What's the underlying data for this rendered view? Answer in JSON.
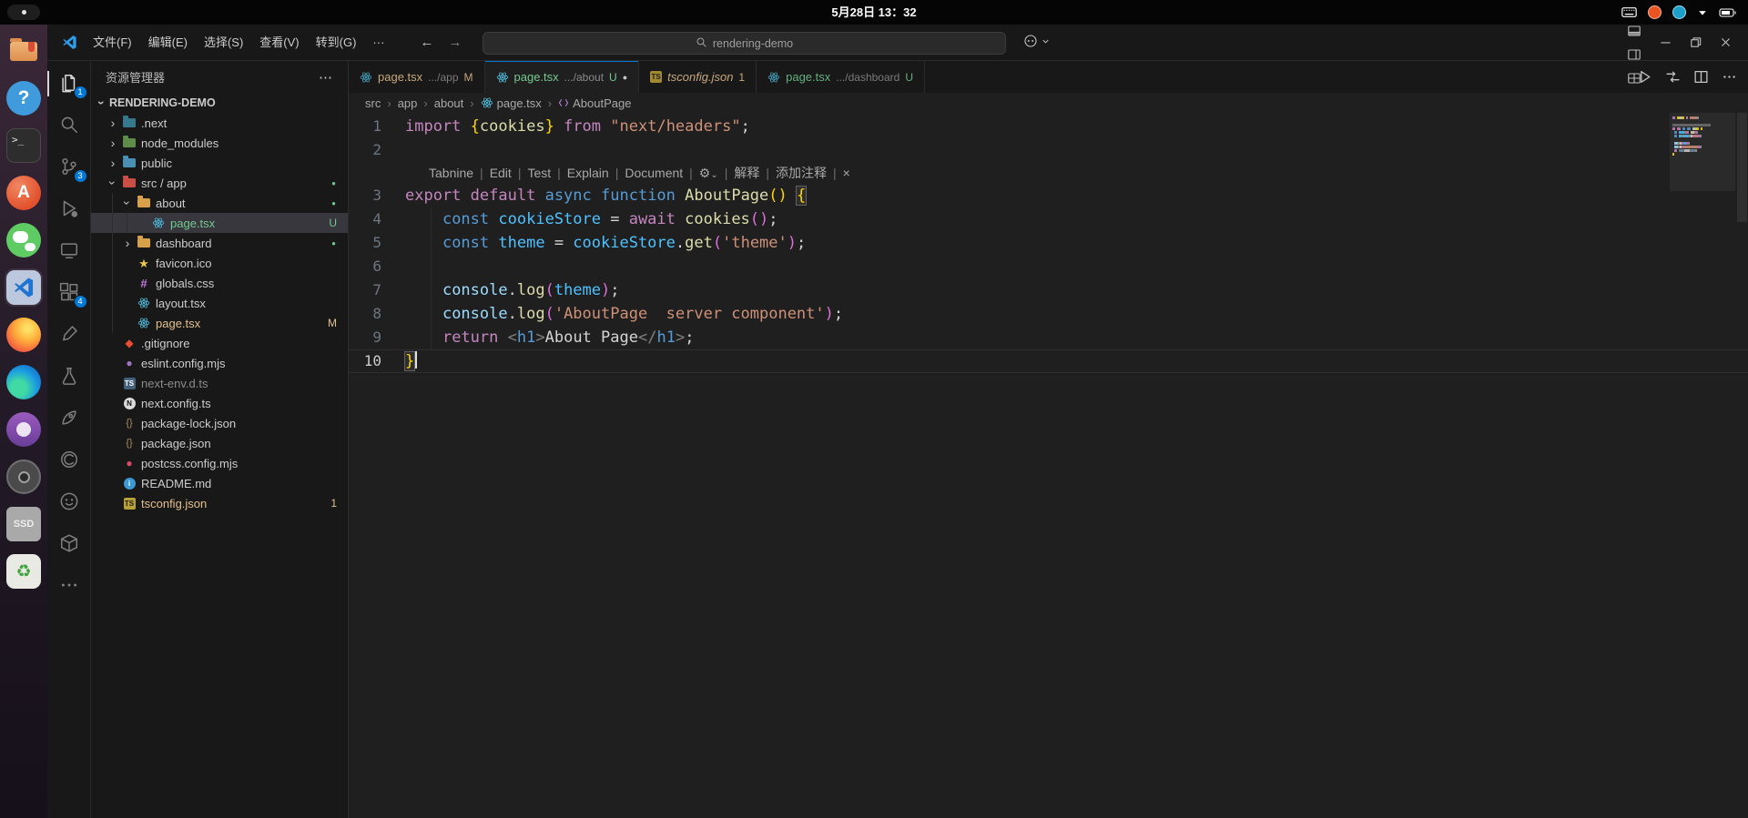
{
  "system_bar": {
    "clock": "5月28日 13：32",
    "tray": [
      "keyboard",
      "recording",
      "network-app",
      "arrow-down",
      "battery"
    ]
  },
  "dock": {
    "items": [
      {
        "name": "file-manager"
      },
      {
        "name": "help"
      },
      {
        "name": "terminal"
      },
      {
        "name": "app-center"
      },
      {
        "name": "wechat"
      },
      {
        "name": "vscode",
        "active": true
      },
      {
        "name": "firefox"
      },
      {
        "name": "edge"
      },
      {
        "name": "purple-app"
      },
      {
        "name": "screenshot-tool"
      },
      {
        "name": "ssd-disk",
        "label": "SSD"
      },
      {
        "name": "recycle-bin"
      }
    ]
  },
  "vscode": {
    "colors": {
      "accent": "#0078D4",
      "git_untracked": "#73C991",
      "git_modified": "#E2C08D"
    },
    "titlebar": {
      "menus": [
        "文件(F)",
        "编辑(E)",
        "选择(S)",
        "查看(V)",
        "转到(G)",
        "···"
      ],
      "search_value": "rendering-demo",
      "layout_buttons": [
        "toggle-sidebar",
        "toggle-panel",
        "toggle-secondary-sidebar",
        "customize-layout"
      ],
      "window_controls": [
        "minimize",
        "restore",
        "close"
      ]
    },
    "activity_bar": {
      "items": [
        {
          "name": "explorer",
          "badge": "1",
          "active": true
        },
        {
          "name": "search"
        },
        {
          "name": "source-control",
          "badge": "3"
        },
        {
          "name": "run-debug"
        },
        {
          "name": "remote-explorer"
        },
        {
          "name": "extensions",
          "badge": "4"
        },
        {
          "name": "brush"
        },
        {
          "name": "testing"
        },
        {
          "name": "rocket"
        },
        {
          "name": "devtools"
        },
        {
          "name": "github"
        },
        {
          "name": "package"
        },
        {
          "name": "more"
        }
      ]
    },
    "sidebar": {
      "title": "资源管理器",
      "more_label": "⋯",
      "project": "RENDERING-DEMO",
      "tree": [
        {
          "label": ".next",
          "icon": "folder",
          "color": "#37798C",
          "level": 0,
          "chevron": "collapsed"
        },
        {
          "label": "node_modules",
          "icon": "folder",
          "color": "#5E8D49",
          "level": 0,
          "chevron": "collapsed"
        },
        {
          "label": "public",
          "icon": "folder",
          "color": "#4A8FB5",
          "level": 0,
          "chevron": "collapsed"
        },
        {
          "label": "src / app",
          "icon": "folder",
          "color": "#C94F46",
          "level": 0,
          "chevron": "expanded",
          "dot": true
        },
        {
          "label": "about",
          "icon": "folder",
          "color": "#D9A04A",
          "level": 1,
          "chevron": "expanded",
          "dot": true
        },
        {
          "label": "page.tsx",
          "icon": "react",
          "level": 2,
          "badge": "U",
          "text_color": "#73C991",
          "selected": true
        },
        {
          "label": "dashboard",
          "icon": "folder",
          "color": "#D9A04A",
          "level": 1,
          "chevron": "collapsed",
          "dot": true
        },
        {
          "label": "favicon.ico",
          "icon": "star",
          "level": 1
        },
        {
          "label": "globals.css",
          "icon": "css",
          "level": 1
        },
        {
          "label": "layout.tsx",
          "icon": "react",
          "level": 1
        },
        {
          "label": "page.tsx",
          "icon": "react",
          "level": 1,
          "badge": "M",
          "text_color": "#E2C08D"
        },
        {
          "label": ".gitignore",
          "icon": "git",
          "level": 0
        },
        {
          "label": "eslint.config.mjs",
          "icon": "eslint",
          "level": 0
        },
        {
          "label": "next-env.d.ts",
          "icon": "ts",
          "level": 0,
          "text_color": "#8C8C8C"
        },
        {
          "label": "next.config.ts",
          "icon": "next",
          "level": 0
        },
        {
          "label": "package-lock.json",
          "icon": "json",
          "level": 0
        },
        {
          "label": "package.json",
          "icon": "json",
          "level": 0
        },
        {
          "label": "postcss.config.mjs",
          "icon": "postcss",
          "level": 0
        },
        {
          "label": "README.md",
          "icon": "info",
          "level": 0
        },
        {
          "label": "tsconfig.json",
          "icon": "tsconfig",
          "level": 0,
          "badge": "1",
          "text_color": "#E2C08D"
        }
      ]
    },
    "tabs": [
      {
        "icon": "react",
        "name": "page.tsx",
        "hint": ".../app",
        "badge": "M",
        "badge_color": "#E2C08D",
        "name_color": "#E2C08D",
        "active": false
      },
      {
        "icon": "react",
        "name": "page.tsx",
        "hint": ".../about",
        "badge": "U",
        "badge_color": "#73C991",
        "name_color": "#73C991",
        "active": true,
        "dirty": true
      },
      {
        "icon": "tsconfig",
        "name": "tsconfig.json",
        "hint": "",
        "badge": "1",
        "badge_color": "#E2C08D",
        "name_color": "#E2C08D",
        "italic": true,
        "active": false
      },
      {
        "icon": "react",
        "name": "page.tsx",
        "hint": ".../dashboard",
        "badge": "U",
        "badge_color": "#73C991",
        "name_color": "#73C991",
        "active": false
      }
    ],
    "editor_actions": [
      "run",
      "compare",
      "split-editor",
      "more"
    ],
    "breadcrumbs": [
      {
        "label": "src"
      },
      {
        "label": "app"
      },
      {
        "label": "about"
      },
      {
        "label": "page.tsx",
        "icon": "react"
      },
      {
        "label": "AboutPage",
        "icon": "symbol"
      }
    ],
    "editor": {
      "codelens": {
        "items": [
          "Tabnine",
          "Edit",
          "Test",
          "Explain",
          "Document"
        ],
        "gear": "⚙",
        "items_cn": [
          "解释",
          "添加注释"
        ],
        "close": "×"
      },
      "lines": [
        {
          "n": 1,
          "tokens": [
            [
              "kw",
              "import"
            ],
            [
              "pun",
              " "
            ],
            [
              "b1",
              "{"
            ],
            [
              "fn",
              "cookies"
            ],
            [
              "b1",
              "}"
            ],
            [
              "pun",
              " "
            ],
            [
              "kw",
              "from"
            ],
            [
              "pun",
              " "
            ],
            [
              "str",
              "\"next/headers\""
            ],
            [
              "pun",
              ";"
            ]
          ]
        },
        {
          "n": 2,
          "tokens": []
        },
        {
          "lens": true
        },
        {
          "n": 3,
          "tokens": [
            [
              "kw",
              "export"
            ],
            [
              "pun",
              " "
            ],
            [
              "kw",
              "default"
            ],
            [
              "pun",
              " "
            ],
            [
              "kw2",
              "async"
            ],
            [
              "pun",
              " "
            ],
            [
              "kw2",
              "function"
            ],
            [
              "pun",
              " "
            ],
            [
              "fn",
              "AboutPage"
            ],
            [
              "b1",
              "()"
            ],
            [
              "pun",
              " "
            ],
            [
              "b1m",
              "{"
            ]
          ]
        },
        {
          "n": 4,
          "tokens": [
            [
              "pun",
              "    "
            ],
            [
              "kw2",
              "const"
            ],
            [
              "pun",
              " "
            ],
            [
              "cvar",
              "cookieStore"
            ],
            [
              "pun",
              " = "
            ],
            [
              "kw",
              "await"
            ],
            [
              "pun",
              " "
            ],
            [
              "fn",
              "cookies"
            ],
            [
              "b2",
              "()"
            ],
            [
              "pun",
              ";"
            ]
          ]
        },
        {
          "n": 5,
          "tokens": [
            [
              "pun",
              "    "
            ],
            [
              "kw2",
              "const"
            ],
            [
              "pun",
              " "
            ],
            [
              "cvar",
              "theme"
            ],
            [
              "pun",
              " = "
            ],
            [
              "cvar",
              "cookieStore"
            ],
            [
              "pun",
              "."
            ],
            [
              "fn",
              "get"
            ],
            [
              "b2",
              "("
            ],
            [
              "str",
              "'theme'"
            ],
            [
              "b2",
              ")"
            ],
            [
              "pun",
              ";"
            ]
          ]
        },
        {
          "n": 6,
          "tokens": []
        },
        {
          "n": 7,
          "tokens": [
            [
              "pun",
              "    "
            ],
            [
              "var",
              "console"
            ],
            [
              "pun",
              "."
            ],
            [
              "fn",
              "log"
            ],
            [
              "b2",
              "("
            ],
            [
              "cvar",
              "theme"
            ],
            [
              "b2",
              ")"
            ],
            [
              "pun",
              ";"
            ]
          ]
        },
        {
          "n": 8,
          "tokens": [
            [
              "pun",
              "    "
            ],
            [
              "var",
              "console"
            ],
            [
              "pun",
              "."
            ],
            [
              "fn",
              "log"
            ],
            [
              "b2",
              "("
            ],
            [
              "str",
              "'AboutPage  server component'"
            ],
            [
              "b2",
              ")"
            ],
            [
              "pun",
              ";"
            ]
          ]
        },
        {
          "n": 9,
          "tokens": [
            [
              "pun",
              "    "
            ],
            [
              "kw",
              "return"
            ],
            [
              "pun",
              " "
            ],
            [
              "tagb",
              "<"
            ],
            [
              "tag",
              "h1"
            ],
            [
              "tagb",
              ">"
            ],
            [
              "txt",
              "About Page"
            ],
            [
              "tagb",
              "</"
            ],
            [
              "tag",
              "h1"
            ],
            [
              "tagb",
              ">"
            ],
            [
              "pun",
              ";"
            ]
          ]
        },
        {
          "n": 10,
          "current": true,
          "tokens": [
            [
              "b1m",
              "}"
            ],
            [
              "cursor",
              ""
            ]
          ]
        }
      ]
    }
  }
}
